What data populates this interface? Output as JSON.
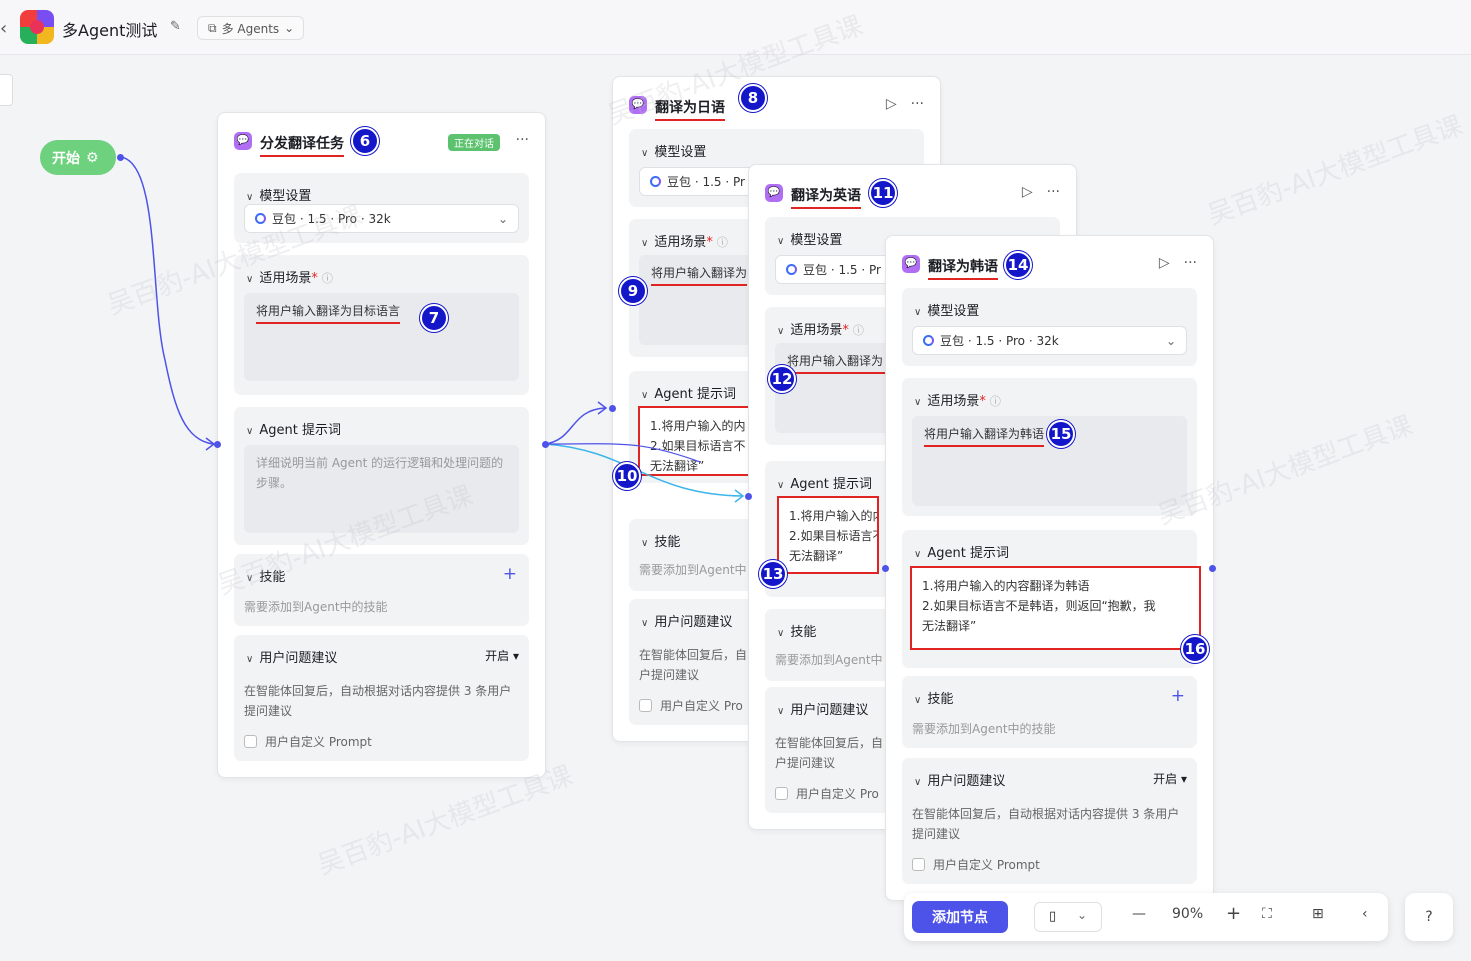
{
  "header": {
    "back_icon": "chevron-left-icon",
    "title": "多Agent测试",
    "mode_label": "多 Agents"
  },
  "start_node": {
    "label": "开始"
  },
  "agent1": {
    "title": "分发翻译任务",
    "live_badge": "正在对话",
    "model_section": "模型设置",
    "model_value": "豆包 · 1.5 · Pro · 32k",
    "scene_section": "适用场景",
    "scene_value": "将用户输入翻译为目标语言",
    "prompt_section": "Agent 提示词",
    "prompt_placeholder": "详细说明当前 Agent 的运行逻辑和处理问题的步骤。",
    "skills_section": "技能",
    "skills_note": "需要添加到Agent中的技能",
    "suggest_section": "用户问题建议",
    "suggest_toggle": "开启",
    "suggest_desc": "在智能体回复后，自动根据对话内容提供 3 条用户提问建议",
    "custom_prompt": "用户自定义 Prompt"
  },
  "agent2": {
    "title": "翻译为日语",
    "model_section": "模型设置",
    "model_value": "豆包 · 1.5 · Pr",
    "scene_section": "适用场景",
    "scene_value": "将用户输入翻译为",
    "prompt_section": "Agent 提示词",
    "prompt_line1": "1.将用户输入的内",
    "prompt_line2": "2.如果目标语言不",
    "prompt_line3": "无法翻译”",
    "skills_section": "技能",
    "skills_note": "需要添加到Agent中",
    "suggest_section": "用户问题建议",
    "suggest_desc_1": "在智能体回复后，自",
    "suggest_desc_2": "户提问建议",
    "custom_prompt": "用户自定义 Pro"
  },
  "agent3": {
    "title": "翻译为英语",
    "model_section": "模型设置",
    "model_value": "豆包 · 1.5 · Pr",
    "scene_section": "适用场景",
    "scene_value": "将用户输入翻译为",
    "prompt_section": "Agent 提示词",
    "prompt_line1": "1.将用户输入的内",
    "prompt_line2": "2.如果目标语言不",
    "prompt_line3": "无法翻译”",
    "skills_section": "技能",
    "skills_note": "需要添加到Agent中",
    "suggest_section": "用户问题建议",
    "suggest_desc_1": "在智能体回复后，自",
    "suggest_desc_2": "户提问建议",
    "custom_prompt": "用户自定义 Pro"
  },
  "agent4": {
    "title": "翻译为韩语",
    "model_section": "模型设置",
    "model_value": "豆包 · 1.5 · Pro · 32k",
    "scene_section": "适用场景",
    "scene_value": "将用户输入翻译为韩语",
    "prompt_section": "Agent 提示词",
    "prompt_line1": "1.将用户输入的内容翻译为韩语",
    "prompt_line2": "2.如果目标语言不是韩语，则返回“抱歉，我",
    "prompt_line3": "无法翻译”",
    "skills_section": "技能",
    "skills_note": "需要添加到Agent中的技能",
    "suggest_section": "用户问题建议",
    "suggest_toggle": "开启",
    "suggest_desc": "在智能体回复后，自动根据对话内容提供 3 条用户提问建议",
    "custom_prompt": "用户自定义 Prompt"
  },
  "markers": [
    "6",
    "7",
    "8",
    "9",
    "10",
    "11",
    "12",
    "13",
    "14",
    "15",
    "16"
  ],
  "watermark": "吴百豹-AI大模型工具课",
  "toolbar": {
    "add_node": "添加节点",
    "zoom": "90%"
  },
  "colors": {
    "accent": "#4d53e8",
    "start_green": "#6dd17d",
    "marker_blue": "#1416c9",
    "highlight_red": "#e02424",
    "edge_cyan": "#3cb6ea"
  }
}
